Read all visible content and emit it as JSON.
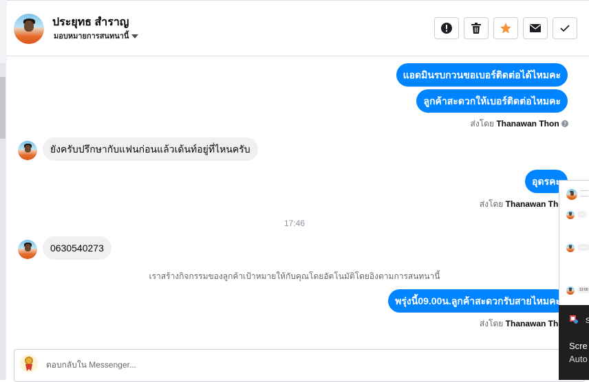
{
  "header": {
    "contact_name": "ประยุทธ สำราญ",
    "assign_label": "มอบหมายการสนทนานี้",
    "actions": [
      {
        "name": "report-spam",
        "icon": "exclamation-circle-icon"
      },
      {
        "name": "delete",
        "icon": "trash-icon"
      },
      {
        "name": "star",
        "icon": "star-icon"
      },
      {
        "name": "mark-unread",
        "icon": "envelope-icon"
      },
      {
        "name": "mark-done",
        "icon": "check-icon"
      }
    ]
  },
  "messages": {
    "out1": "แอดมินรบกวนขอเบอร์ติดต่อได้ไหมคะ",
    "out2": "ลูกค้าสะดวกให้เบอร์ติดต่อไหมคะ",
    "sender1_prefix": "ส่งโดย",
    "sender1_name": "Thanawan Thon",
    "in1": "ยังครับปรึกษากับแฟนก่อนแล้วเด้นท์อยู่ที่ไหนครับ",
    "out3": "อุดรคะ",
    "sender2_prefix": "ส่งโดย",
    "sender2_name": "Thanawan Thon",
    "timestamp": "17:46",
    "in2": "0630540273",
    "system_note": "เราสร้างกิจกรรมของลูกค้าเป้าหมายให้กับคุณโดยอัตโนมัติโดยอิงตามการสนทนานี้",
    "out4": "พรุ่งนี้09.00น.ลูกค้าสะดวกรับสายไหมคะ",
    "sender3_prefix": "ส่งโดย",
    "sender3_name": "Thanawan Thon"
  },
  "composer": {
    "placeholder": "ตอบกลับใน Messenger..."
  },
  "overlay": {
    "preview_time": "13:00",
    "notification_app": "S",
    "notification_line1": "Scre",
    "notification_line2": "Auto"
  },
  "colors": {
    "outgoing_bubble": "#0084ff",
    "incoming_bubble": "#f0f0f0",
    "star": "#f7923a"
  }
}
